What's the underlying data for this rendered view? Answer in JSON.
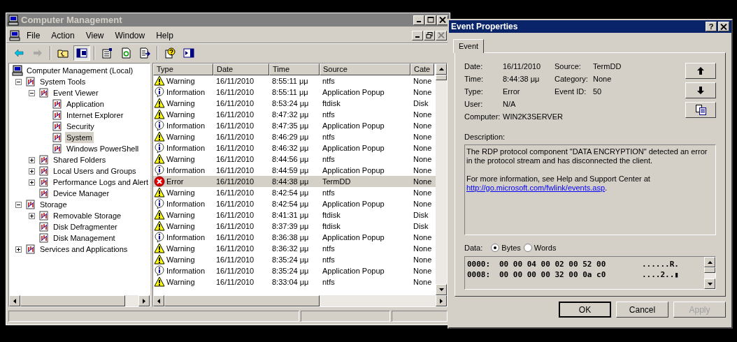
{
  "main_window": {
    "title": "Computer Management",
    "active": false
  },
  "menu": [
    "File",
    "Action",
    "View",
    "Window",
    "Help"
  ],
  "toolbar": [
    {
      "kind": "back",
      "disabled": false,
      "pressed": false
    },
    {
      "kind": "forward",
      "disabled": true,
      "pressed": false
    },
    {
      "kind": "up",
      "disabled": false,
      "pressed": false
    },
    {
      "kind": "tree",
      "disabled": false,
      "pressed": true
    },
    {
      "kind": "properties",
      "disabled": false,
      "pressed": false
    },
    {
      "kind": "refresh",
      "disabled": false,
      "pressed": false
    },
    {
      "kind": "export",
      "disabled": false,
      "pressed": false
    },
    {
      "kind": "help",
      "disabled": false,
      "pressed": false
    },
    {
      "kind": "pane",
      "disabled": false,
      "pressed": false
    }
  ],
  "tree": [
    {
      "label": "Computer Management (Local)",
      "selected": false,
      "children": [
        {
          "label": "System Tools",
          "selected": false,
          "expanded": true,
          "children": [
            {
              "label": "Event Viewer",
              "selected": false,
              "expanded": true,
              "children": [
                {
                  "label": "Application",
                  "selected": false
                },
                {
                  "label": "Internet Explorer",
                  "selected": false
                },
                {
                  "label": "Security",
                  "selected": false
                },
                {
                  "label": "System",
                  "selected": true
                },
                {
                  "label": "Windows PowerShell",
                  "selected": false
                }
              ]
            },
            {
              "label": "Shared Folders",
              "selected": false,
              "expanded": false
            },
            {
              "label": "Local Users and Groups",
              "selected": false,
              "expanded": false
            },
            {
              "label": "Performance Logs and Alert",
              "selected": false,
              "expanded": false
            },
            {
              "label": "Device Manager",
              "selected": false
            }
          ]
        },
        {
          "label": "Storage",
          "selected": false,
          "expanded": true,
          "children": [
            {
              "label": "Removable Storage",
              "selected": false,
              "expanded": false
            },
            {
              "label": "Disk Defragmenter",
              "selected": false
            },
            {
              "label": "Disk Management",
              "selected": false
            }
          ]
        },
        {
          "label": "Services and Applications",
          "selected": false,
          "expanded": false
        }
      ]
    }
  ],
  "table": {
    "columns": [
      "Type",
      "Date",
      "Time",
      "Source",
      "Cate"
    ],
    "rows": [
      {
        "kind": "warning",
        "selected": false,
        "cells": [
          "Warning",
          "16/11/2010",
          "8:55:11 μμ",
          "ntfs",
          "None"
        ]
      },
      {
        "kind": "information",
        "selected": false,
        "cells": [
          "Information",
          "16/11/2010",
          "8:55:11 μμ",
          "Application Popup",
          "None"
        ]
      },
      {
        "kind": "warning",
        "selected": false,
        "cells": [
          "Warning",
          "16/11/2010",
          "8:53:24 μμ",
          "ftdisk",
          "Disk"
        ]
      },
      {
        "kind": "warning",
        "selected": false,
        "cells": [
          "Warning",
          "16/11/2010",
          "8:47:32 μμ",
          "ntfs",
          "None"
        ]
      },
      {
        "kind": "information",
        "selected": false,
        "cells": [
          "Information",
          "16/11/2010",
          "8:47:35 μμ",
          "Application Popup",
          "None"
        ]
      },
      {
        "kind": "warning",
        "selected": false,
        "cells": [
          "Warning",
          "16/11/2010",
          "8:46:29 μμ",
          "ntfs",
          "None"
        ]
      },
      {
        "kind": "information",
        "selected": false,
        "cells": [
          "Information",
          "16/11/2010",
          "8:46:32 μμ",
          "Application Popup",
          "None"
        ]
      },
      {
        "kind": "warning",
        "selected": false,
        "cells": [
          "Warning",
          "16/11/2010",
          "8:44:56 μμ",
          "ntfs",
          "None"
        ]
      },
      {
        "kind": "information",
        "selected": false,
        "cells": [
          "Information",
          "16/11/2010",
          "8:44:59 μμ",
          "Application Popup",
          "None"
        ]
      },
      {
        "kind": "error",
        "selected": true,
        "cells": [
          "Error",
          "16/11/2010",
          "8:44:38 μμ",
          "TermDD",
          "None"
        ]
      },
      {
        "kind": "warning",
        "selected": false,
        "cells": [
          "Warning",
          "16/11/2010",
          "8:42:54 μμ",
          "ntfs",
          "None"
        ]
      },
      {
        "kind": "information",
        "selected": false,
        "cells": [
          "Information",
          "16/11/2010",
          "8:42:54 μμ",
          "Application Popup",
          "None"
        ]
      },
      {
        "kind": "warning",
        "selected": false,
        "cells": [
          "Warning",
          "16/11/2010",
          "8:41:31 μμ",
          "ftdisk",
          "Disk"
        ]
      },
      {
        "kind": "warning",
        "selected": false,
        "cells": [
          "Warning",
          "16/11/2010",
          "8:37:39 μμ",
          "ftdisk",
          "Disk"
        ]
      },
      {
        "kind": "information",
        "selected": false,
        "cells": [
          "Information",
          "16/11/2010",
          "8:36:38 μμ",
          "Application Popup",
          "None"
        ]
      },
      {
        "kind": "warning",
        "selected": false,
        "cells": [
          "Warning",
          "16/11/2010",
          "8:36:32 μμ",
          "ntfs",
          "None"
        ]
      },
      {
        "kind": "warning",
        "selected": false,
        "cells": [
          "Warning",
          "16/11/2010",
          "8:35:24 μμ",
          "ntfs",
          "None"
        ]
      },
      {
        "kind": "information",
        "selected": false,
        "cells": [
          "Information",
          "16/11/2010",
          "8:35:24 μμ",
          "Application Popup",
          "None"
        ]
      },
      {
        "kind": "warning",
        "selected": false,
        "cells": [
          "Warning",
          "16/11/2010",
          "8:33:04 μμ",
          "ntfs",
          "None"
        ]
      }
    ]
  },
  "dialog": {
    "title": "Event Properties",
    "help_button": "?",
    "tabs": [
      {
        "label": "Event",
        "selected": true
      }
    ],
    "fields_left": [
      {
        "label": "Date:",
        "value": "16/11/2010"
      },
      {
        "label": "Time:",
        "value": "8:44:38 μμ"
      },
      {
        "label": "Type:",
        "value": "Error"
      },
      {
        "label": "User:",
        "value": "N/A"
      },
      {
        "label": "Computer:",
        "value": "WIN2K3SERVER"
      }
    ],
    "fields_right": [
      {
        "label": "Source:",
        "value": "TermDD"
      },
      {
        "label": "Category:",
        "value": "None"
      },
      {
        "label": "Event ID:",
        "value": "50"
      }
    ],
    "description_label": "Description:",
    "description": [
      "The RDP protocol component \"DATA ENCRYPTION\" detected an error in the protocol stream and has disconnected the client.",
      {
        "text": "For more information, see Help and Support Center at",
        "link": "http://go.microsoft.com/fwlink/events.asp",
        "after": "."
      }
    ],
    "data_label": "Data:",
    "data_format": [
      {
        "label": "Bytes",
        "selected": true
      },
      {
        "label": "Words",
        "selected": false
      }
    ],
    "data_lines": [
      {
        "offset": "0000:",
        "hex": "00 00 04 00 02 00 52 00",
        "ascii": "......R."
      },
      {
        "offset": "0008:",
        "hex": "00 00 00 00 32 00 0a c0",
        "ascii": "....2..▮"
      }
    ],
    "buttons": [
      {
        "label": "OK",
        "disabled": false,
        "default": true
      },
      {
        "label": "Cancel",
        "disabled": false,
        "default": false
      },
      {
        "label": "Apply",
        "disabled": true,
        "default": false
      }
    ]
  }
}
